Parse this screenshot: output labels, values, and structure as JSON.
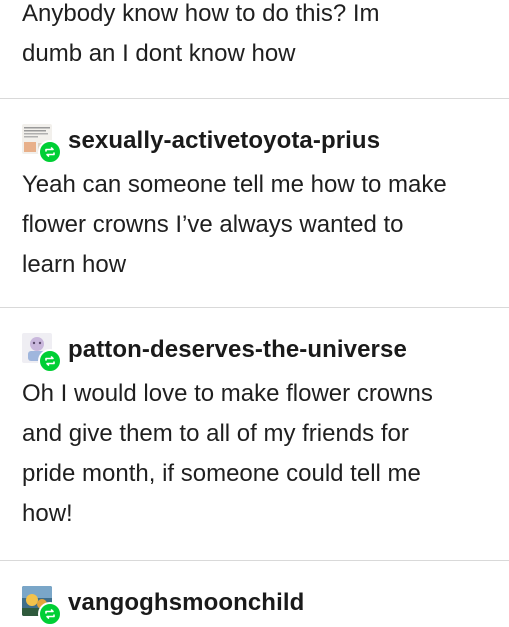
{
  "posts": [
    {
      "username": "",
      "text_lines": [
        "Anybody know how to do this? Im",
        "dumb an I dont know how"
      ]
    },
    {
      "username": "sexually-activetoyota-prius",
      "avatar_icon": "text-screenshot-avatar",
      "badge_icon": "reblog-icon",
      "text_lines": [
        "Yeah can someone tell me how to make",
        "flower crowns I’ve always wanted to",
        "learn how"
      ]
    },
    {
      "username": "patton-deserves-the-universe",
      "avatar_icon": "drawing-avatar",
      "badge_icon": "reblog-icon",
      "text_lines": [
        "Oh I would love to make flower crowns",
        "and give them to all of my friends for",
        "pride month, if someone could tell me",
        "how!"
      ]
    },
    {
      "username": "vangoghsmoonchild",
      "avatar_icon": "painting-avatar",
      "badge_icon": "reblog-icon",
      "text_lines": []
    }
  ],
  "colors": {
    "reblog_badge": "#00cf35",
    "divider": "#d9d9d9",
    "text": "#1f1f1f"
  }
}
